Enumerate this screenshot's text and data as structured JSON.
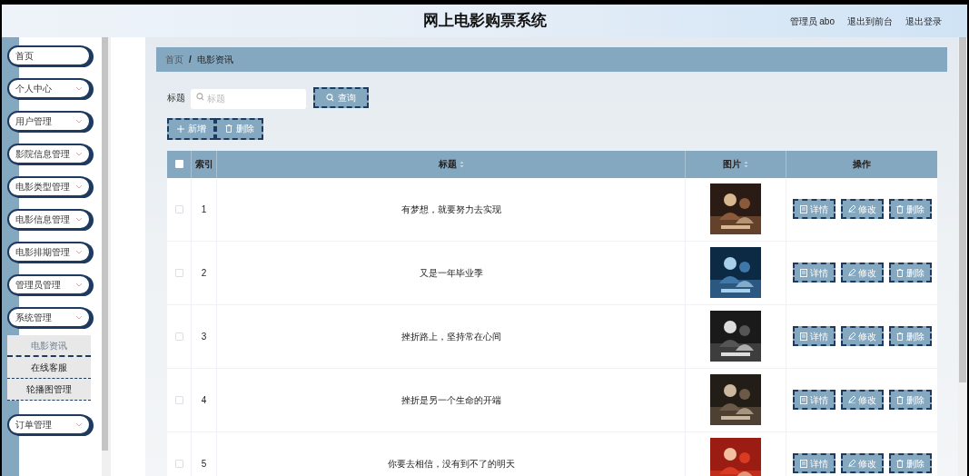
{
  "header": {
    "title": "网上电影购票系统",
    "links": [
      "管理员 abo",
      "退出到前台",
      "退出登录"
    ]
  },
  "sidebar": {
    "items": [
      {
        "label": "首页",
        "has_children": false
      },
      {
        "label": "个人中心",
        "has_children": true,
        "expanded": false
      },
      {
        "label": "用户管理",
        "has_children": true,
        "expanded": false
      },
      {
        "label": "影院信息管理",
        "has_children": true,
        "expanded": false
      },
      {
        "label": "电影类型管理",
        "has_children": true,
        "expanded": false
      },
      {
        "label": "电影信息管理",
        "has_children": true,
        "expanded": false
      },
      {
        "label": "电影排期管理",
        "has_children": true,
        "expanded": false
      },
      {
        "label": "管理员管理",
        "has_children": true,
        "expanded": false
      },
      {
        "label": "系统管理",
        "has_children": true,
        "expanded": true,
        "children": [
          {
            "label": "电影资讯",
            "selected": true
          },
          {
            "label": "在线客服",
            "selected": false
          },
          {
            "label": "轮播图管理",
            "selected": false
          }
        ]
      },
      {
        "label": "订单管理",
        "has_children": true,
        "expanded": false
      }
    ]
  },
  "breadcrumb": [
    "首页",
    "电影资讯"
  ],
  "breadcrumb_separator": "/",
  "search": {
    "label": "标题",
    "placeholder": "标题",
    "button": "查询"
  },
  "toolbar": [
    {
      "kind": "add",
      "label": "新增"
    },
    {
      "kind": "delete",
      "label": "删除"
    }
  ],
  "table": {
    "select_all": {
      "checked": false
    },
    "columns": [
      {
        "label": "索引",
        "sortable": false
      },
      {
        "label": "标题",
        "sortable": true
      },
      {
        "label": "图片",
        "sortable": true
      },
      {
        "label": "操作",
        "sortable": false
      }
    ],
    "rows": [
      {
        "checked": false,
        "index": "1",
        "title": "有梦想，就要努力去实现",
        "image": {
          "kind": "picture"
        },
        "actions": [
          {
            "kind": "detail",
            "label": "详情"
          },
          {
            "kind": "edit",
            "label": "修改"
          },
          {
            "kind": "delete",
            "label": "删除"
          }
        ]
      },
      {
        "checked": false,
        "index": "2",
        "title": "又是一年毕业季",
        "image": {
          "kind": "picture"
        },
        "actions": [
          {
            "kind": "detail",
            "label": "详情"
          },
          {
            "kind": "edit",
            "label": "修改"
          },
          {
            "kind": "delete",
            "label": "删除"
          }
        ]
      },
      {
        "checked": false,
        "index": "3",
        "title": "挫折路上，坚持常在心间",
        "image": {
          "kind": "picture"
        },
        "actions": [
          {
            "kind": "detail",
            "label": "详情"
          },
          {
            "kind": "edit",
            "label": "修改"
          },
          {
            "kind": "delete",
            "label": "删除"
          }
        ]
      },
      {
        "checked": false,
        "index": "4",
        "title": "挫折是另一个生命的开端",
        "image": {
          "kind": "picture"
        },
        "actions": [
          {
            "kind": "detail",
            "label": "详情"
          },
          {
            "kind": "edit",
            "label": "修改"
          },
          {
            "kind": "delete",
            "label": "删除"
          }
        ]
      },
      {
        "checked": false,
        "index": "5",
        "title": "你要去相信，没有到不了的明天",
        "image": {
          "kind": "picture"
        },
        "actions": [
          {
            "kind": "detail",
            "label": "详情"
          },
          {
            "kind": "edit",
            "label": "修改"
          },
          {
            "kind": "delete",
            "label": "删除"
          }
        ]
      }
    ]
  }
}
